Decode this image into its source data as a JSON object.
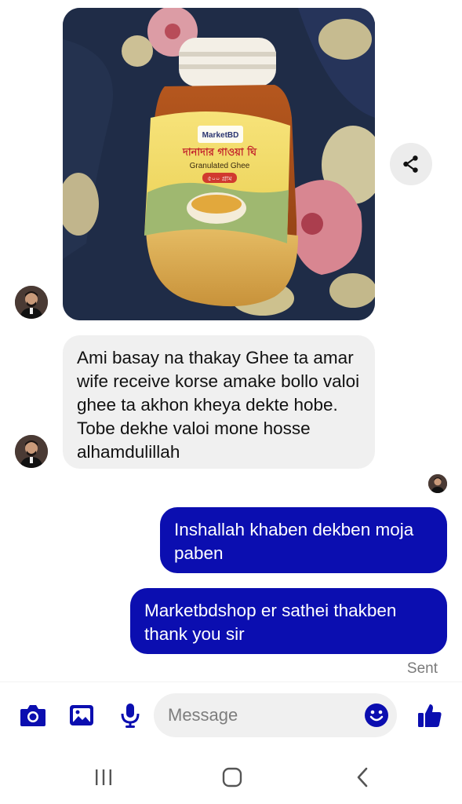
{
  "photo": {
    "label_brand": "MarketBD",
    "label_bengali": "দানাদার গাওয়া ঘি",
    "label_english": "Granulated Ghee",
    "label_badge": "৫০০ গ্রাম"
  },
  "messages": {
    "incoming_text": "Ami basay na thakay Ghee ta amar wife receive korse amake bollo valoi ghee ta akhon kheya dekte hobe. Tobe dekhe valoi mone hosse alhamdulillah",
    "outgoing": [
      {
        "text": "Inshallah khaben dekben moja paben"
      },
      {
        "text": "Marketbdshop er sathei thakben thank you sir"
      }
    ],
    "status": "Sent"
  },
  "composer": {
    "placeholder": "Message",
    "icons": [
      "camera-icon",
      "gallery-icon",
      "microphone-icon",
      "emoji-icon",
      "thumbs-up-icon"
    ]
  },
  "navbar": {
    "icons": [
      "recent-apps-icon",
      "home-icon",
      "back-icon"
    ]
  },
  "colors": {
    "accent": "#0b0eb0",
    "incoming_bubble": "#f0f0f0",
    "status_text": "#7a7a7a"
  }
}
